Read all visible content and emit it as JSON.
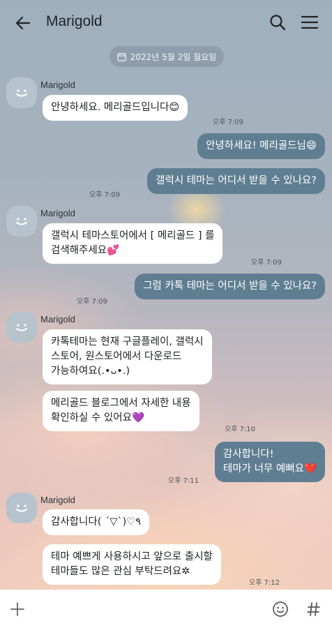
{
  "header": {
    "title": "Marigold",
    "icons": [
      "arrow-left-icon",
      "search-icon",
      "hamburger-menu-icon"
    ]
  },
  "date_divider": "2022년 5월 2일 월요일",
  "sender_name": "Marigold",
  "messages": [
    {
      "from": "marigold",
      "text": "안녕하세요. 메리골드입니다😊",
      "time": "오후 7:09"
    },
    {
      "from": "me",
      "text": "안녕하세요! 메리골드님😄",
      "time": ""
    },
    {
      "from": "me",
      "text": "갤럭시 테마는 어디서 받을 수 있나요?",
      "time": "오후 7:09"
    },
    {
      "from": "marigold",
      "text": "갤럭시 테마스토어에서 [ 메리골드 ] 를\n검색해주세요💕",
      "time": "오후 7:09"
    },
    {
      "from": "me",
      "text": "그럼 카톡 테마는 어디서 받을 수 있나요?",
      "time": "오후 7:09"
    },
    {
      "from": "marigold",
      "text": "카톡테마는 현재 구글플레이, 갤럭시\n스토어, 원스토어에서 다운로드\n가능하여요(.•ᴗ•.)",
      "time": ""
    },
    {
      "from": "marigold",
      "text": "메리골드 블로그에서 자세한 내용\n확인하실 수 있어요💜",
      "time": "오후 7:10"
    },
    {
      "from": "me",
      "text": "감사합니다!\n테마가 너무 예뻐요❤️",
      "time": "오후 7:11"
    },
    {
      "from": "marigold",
      "text": "감사합니다( ˊ▽ˋ)♡٩",
      "time": ""
    },
    {
      "from": "marigold",
      "text": "테마 예쁘게 사용하시고 앞으로 출시할\n테마들도 많은 관심 부탁드려요✲",
      "time": "오후 7:12"
    }
  ],
  "input": {
    "placeholder": ""
  },
  "bottom_icons": [
    "plus-icon",
    "emoji-icon",
    "hashtag-icon"
  ],
  "colors": {
    "outgoing_bubble": "#5f7e92",
    "incoming_bubble": "#ffffff",
    "bottom_bar": "#ffffff"
  }
}
